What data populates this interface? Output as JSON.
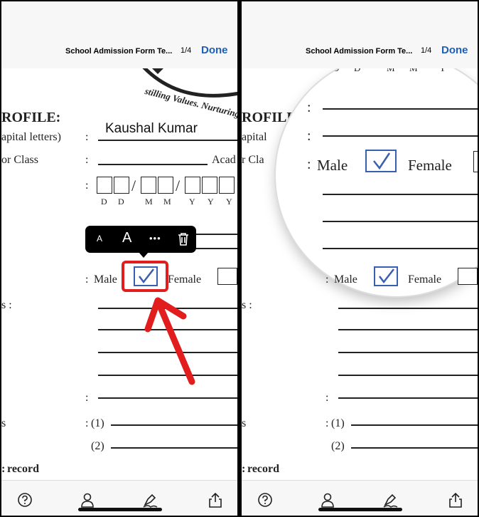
{
  "nav": {
    "title": "School Admission Form Te...",
    "page_indicator": "1/4",
    "done_label": "Done"
  },
  "form": {
    "logo_text": "stilling Values. Nurturing",
    "profile_heading": "ROFILE:",
    "name_label": "apital letters)",
    "class_label": "or Class",
    "academic_label": "Acad",
    "colon": ":",
    "date_letters": [
      "D",
      "D",
      "M",
      "M",
      "Y",
      "Y",
      "Y"
    ],
    "male_label": "Male",
    "female_label": "Female",
    "s_label": "s :",
    "s2_label": "s",
    "option1": "(1)",
    "option2": "(2)",
    "record_label": "record",
    "entered_name": "Kaushal Kumar"
  },
  "magnifier": {
    "date_letters": [
      "D",
      "D",
      "M",
      "M",
      "Y"
    ],
    "profile_heading": "ROFILE",
    "name_label": "apital",
    "class_label": "r Cla",
    "male_label": "Male",
    "female_label": "Female"
  },
  "toolbar": {
    "small_a": "A",
    "large_a": "A",
    "more": "•••",
    "delete_icon": "trash-icon"
  },
  "tabbar": {
    "icons": [
      "help-icon",
      "profile-icon",
      "signature-icon",
      "share-icon"
    ]
  },
  "colors": {
    "accent": "#1f5fb4",
    "highlight": "#e21d1d",
    "checkbox": "#3a5fb0"
  }
}
